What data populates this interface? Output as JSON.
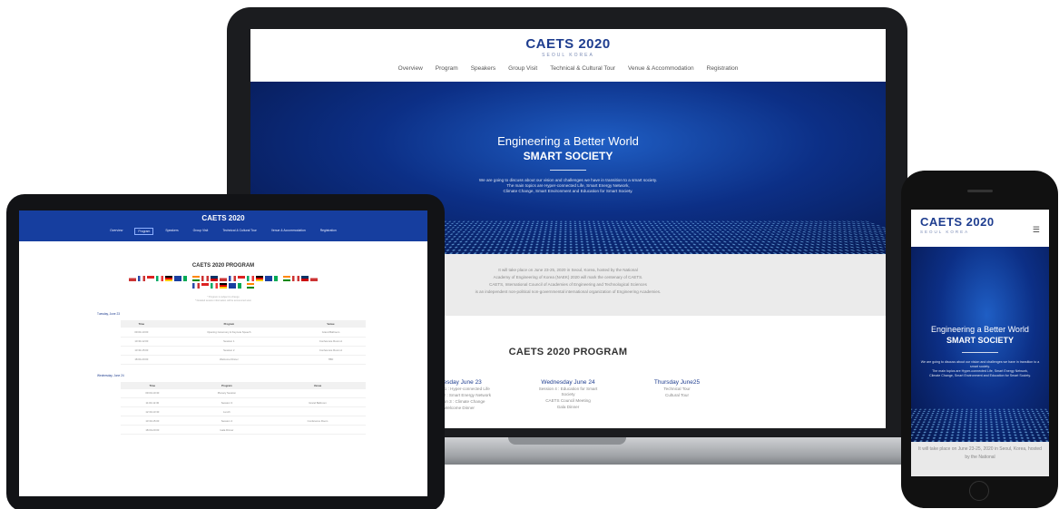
{
  "colors": {
    "brand_navy": "#1e3d8f",
    "hero_blue": "#0c2f86",
    "tablet_header": "#163e9f",
    "intro_gray": "#ebebeb"
  },
  "site": {
    "logo": "CAETS 2020",
    "logo_sub": "SEOUL KOREA",
    "nav": [
      "Overview",
      "Program",
      "Speakers",
      "Group Visit",
      "Technical & Cultural Tour",
      "Venue & Accommodation",
      "Registration"
    ],
    "hero": {
      "title": "Engineering a Better World",
      "subtitle": "SMART SOCIETY",
      "body": [
        "We are going to discuss about our vision and challenges we have in transition to a smart society.",
        "The main topics are Hyper-connected Life, Smart Energy Network,",
        "Climate Change, Smart Environment and Education for Smart Society."
      ]
    },
    "intro": [
      "It will take place on June 23-25, 2020 in Seoul, Korea, hosted by the National",
      "Academy of Engineering of Korea (NAEK) 2020 will mark the centenary of CAETS.",
      "CAETS, International Council of Academies of Engineering and Technological Sciences",
      "is an independent non-political non-governmental international organization of Engineering Academies."
    ],
    "program_title": "CAETS 2020 PROGRAM",
    "days": [
      {
        "name": "Tuesday June 23",
        "items": [
          "Session 1 : Hyper-connected Life",
          "Session 2 : Smart Energy Network",
          "Session 3 : Climate Change",
          "Welcome Dinner"
        ]
      },
      {
        "name": "Wednesday June 24",
        "items": [
          "Session 4 : Education for Smart Society",
          "CAETS Council Meeting",
          "Gala Dinner"
        ]
      },
      {
        "name": "Thursday June25",
        "items": [
          "Technical Tour",
          "Cultural Tour"
        ]
      }
    ],
    "flags_count": 28,
    "program_note": [
      "* Program is subject to change",
      "* Detailed session information will be announced soon"
    ],
    "tablet_days": [
      {
        "title": "Tuesday, June 23",
        "headers": [
          "Time",
          "Program",
          "Venue"
        ],
        "rows": [
          [
            "09:00-10:00",
            "Opening Ceremony & Keynote Speech",
            "Grand Ballroom"
          ],
          [
            "10:30-12:00",
            "Session 1",
            "Conference Room A"
          ],
          [
            "13:30-15:00",
            "Session 2",
            "Conference Room A"
          ],
          [
            "18:00-20:00",
            "Welcome Dinner",
            "TBD"
          ]
        ]
      },
      {
        "title": "Wednesday, June 24",
        "headers": [
          "Time",
          "Program",
          "Venue"
        ],
        "rows": [
          [
            "09:00-10:30",
            "Plenary Session",
            ""
          ],
          [
            "11:00-12:30",
            "Session 3",
            "Grand Ballroom"
          ],
          [
            "12:30-13:30",
            "Lunch",
            ""
          ],
          [
            "13:30-15:00",
            "Session 4",
            "Conference Room"
          ],
          [
            "18:00-20:00",
            "Gala Dinner",
            ""
          ]
        ]
      }
    ],
    "phone_intro": "It will take place on June 23-25, 2020 in Seoul, Korea, hosted by the National"
  }
}
